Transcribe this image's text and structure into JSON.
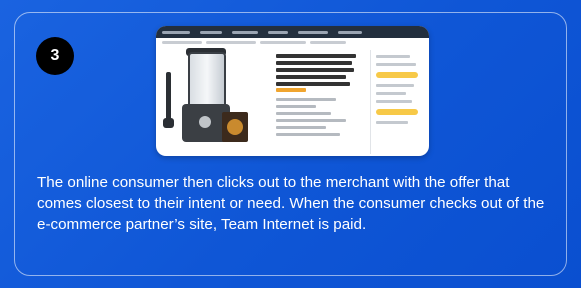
{
  "step": {
    "number": "3"
  },
  "caption": {
    "text": "The online consumer then clicks out to the merchant with the offer that comes closest to their intent or need. When the consumer checks out of the e-commerce partner’s site, Team Internet is paid."
  },
  "colors": {
    "background": "#1060d8",
    "badge": "#000000",
    "text": "#ffffff"
  }
}
